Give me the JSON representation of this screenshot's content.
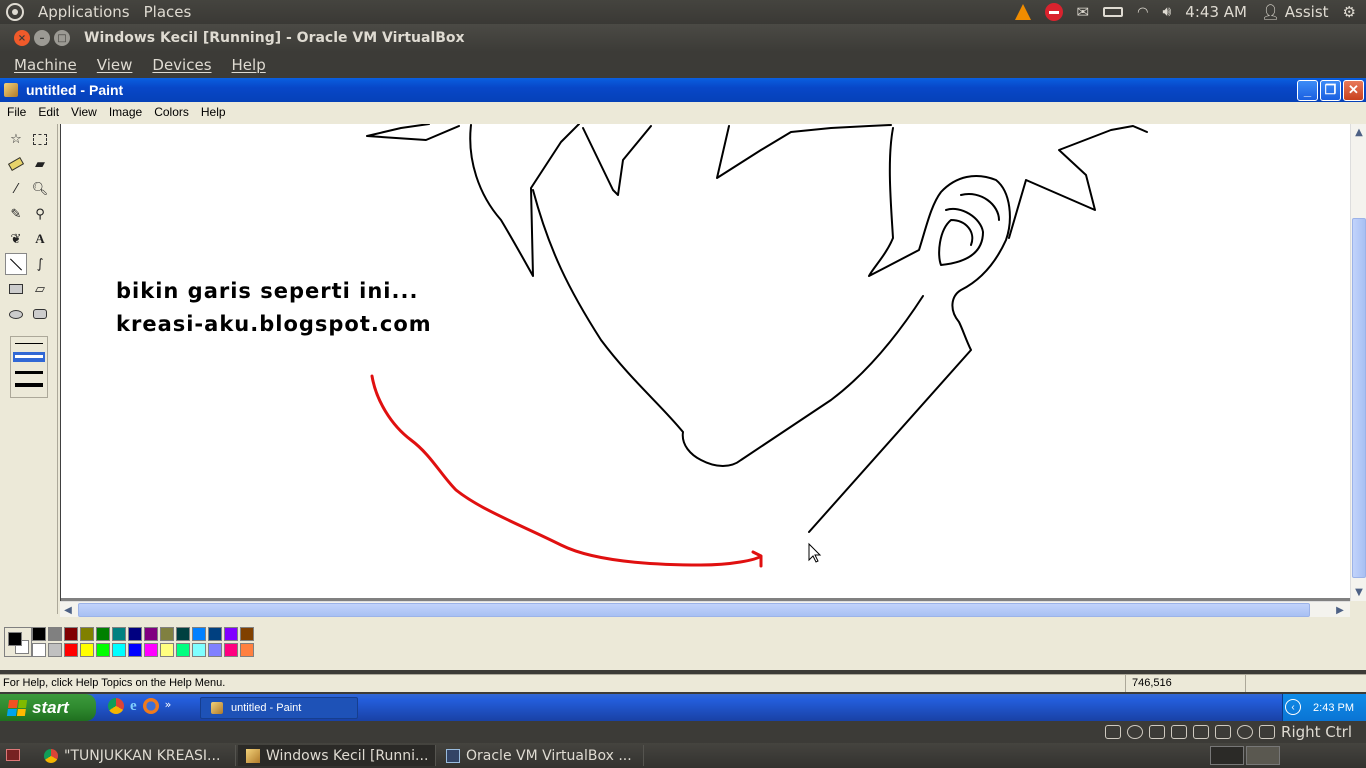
{
  "ubuntu_top": {
    "applications": "Applications",
    "places": "Places",
    "time": "4:43 AM",
    "user": "Assist"
  },
  "vbox": {
    "title": "Windows Kecil [Running] - Oracle VM VirtualBox",
    "menu": [
      "Machine",
      "View",
      "Devices",
      "Help"
    ],
    "host_key": "Right Ctrl"
  },
  "paint": {
    "title": "untitled - Paint",
    "menu": [
      "File",
      "Edit",
      "View",
      "Image",
      "Colors",
      "Help"
    ],
    "canvas_text_line1": "bikin garis seperti ini...",
    "canvas_text_line2": "kreasi-aku.blogspot.com",
    "status_help": "For Help, click Help Topics on the Help Menu.",
    "status_coords": "746,516",
    "palette_top": [
      "#000000",
      "#808080",
      "#800000",
      "#808000",
      "#008000",
      "#008080",
      "#000080",
      "#800080",
      "#808040",
      "#004040",
      "#0080ff",
      "#004080",
      "#8000ff",
      "#804000"
    ],
    "palette_bottom": [
      "#ffffff",
      "#c0c0c0",
      "#ff0000",
      "#ffff00",
      "#00ff00",
      "#00ffff",
      "#0000ff",
      "#ff00ff",
      "#ffff80",
      "#00ff80",
      "#80ffff",
      "#8080ff",
      "#ff0080",
      "#ff8040"
    ],
    "primary_color": "#000000",
    "secondary_color": "#ffffff"
  },
  "xp_taskbar": {
    "start": "start",
    "task": "untitled - Paint",
    "clock": "2:43 PM"
  },
  "ubuntu_bottom": {
    "tasks": [
      "\"TUNJUKKAN KREASI...",
      "Windows Kecil [Runni...",
      "Oracle VM VirtualBox ..."
    ]
  }
}
